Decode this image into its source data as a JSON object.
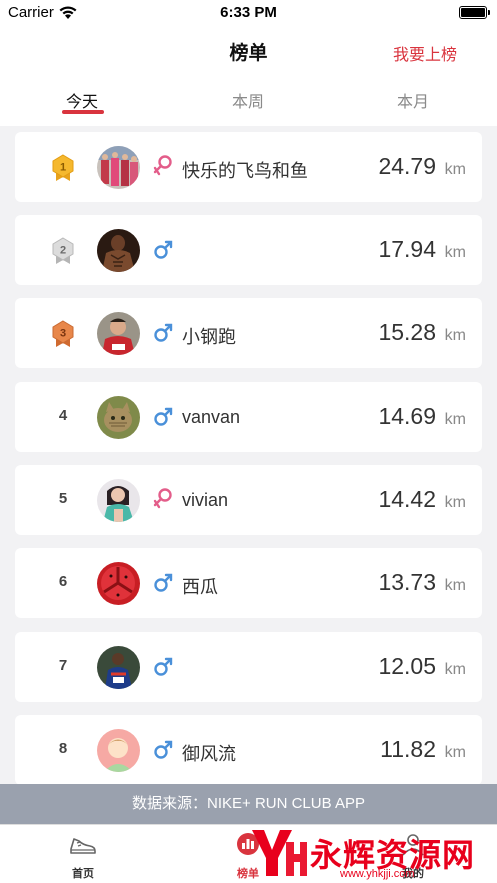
{
  "status_bar": {
    "carrier": "Carrier",
    "time": "6:33 PM"
  },
  "nav": {
    "title": "榜单",
    "action": "我要上榜"
  },
  "tabs": [
    {
      "label": "今天",
      "active": true
    },
    {
      "label": "本周",
      "active": false
    },
    {
      "label": "本月",
      "active": false
    }
  ],
  "leaderboard": [
    {
      "rank": "1",
      "medal": "gold",
      "avatar": "runner-group-photo",
      "gender": "female",
      "name": "快乐的飞鸟和鱼",
      "distance": "24.79",
      "unit": "km"
    },
    {
      "rank": "2",
      "medal": "silver",
      "avatar": "muscle-photo",
      "gender": "male",
      "name": "",
      "distance": "17.94",
      "unit": "km"
    },
    {
      "rank": "3",
      "medal": "bronze",
      "avatar": "runner-red-shirt-photo",
      "gender": "male",
      "name": "小钢跑",
      "distance": "15.28",
      "unit": "km"
    },
    {
      "rank": "4",
      "medal": "",
      "avatar": "cat-photo",
      "gender": "male",
      "name": "vanvan",
      "distance": "14.69",
      "unit": "km"
    },
    {
      "rank": "5",
      "medal": "",
      "avatar": "woman-photo",
      "gender": "female",
      "name": "vivian",
      "distance": "14.42",
      "unit": "km"
    },
    {
      "rank": "6",
      "medal": "",
      "avatar": "watermelon-photo",
      "gender": "male",
      "name": "西瓜",
      "distance": "13.73",
      "unit": "km"
    },
    {
      "rank": "7",
      "medal": "",
      "avatar": "marathon-runner-photo",
      "gender": "male",
      "name": "",
      "distance": "12.05",
      "unit": "km"
    },
    {
      "rank": "8",
      "medal": "",
      "avatar": "default-avatar",
      "gender": "male",
      "name": "御风流",
      "distance": "11.82",
      "unit": "km"
    }
  ],
  "source": "数据来源：NIKE+ RUN CLUB APP",
  "tab_bar": [
    {
      "label": "首页",
      "icon": "shoe-icon",
      "active": false
    },
    {
      "label": "榜单",
      "icon": "leaderboard-icon",
      "active": true
    },
    {
      "label": "我的",
      "icon": "profile-icon",
      "active": false
    }
  ],
  "watermark": {
    "text": "永辉资源网",
    "url": "www.yhkjji.com"
  },
  "colors": {
    "accent": "#d9343e",
    "male": "#4a90d9",
    "female": "#e35d8a",
    "gold": "#f5b82e",
    "silver": "#c9c9c9",
    "bronze": "#e8874a",
    "banner": "#9aa1ae"
  }
}
